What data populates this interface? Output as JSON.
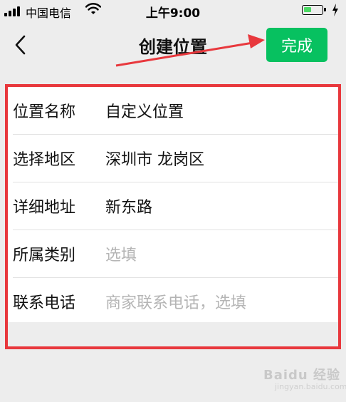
{
  "status_bar": {
    "carrier": "中国电信",
    "time": "上午9:00",
    "battery_level": 0.45
  },
  "nav": {
    "title": "创建位置",
    "done_label": "完成",
    "accent_color": "#07c160"
  },
  "form": {
    "rows": [
      {
        "label": "位置名称",
        "value": "自定义位置",
        "placeholder": ""
      },
      {
        "label": "选择地区",
        "value": "深圳市 龙岗区",
        "placeholder": ""
      },
      {
        "label": "详细地址",
        "value": "新东路",
        "placeholder": ""
      },
      {
        "label": "所属类别",
        "value": "",
        "placeholder": "选填"
      },
      {
        "label": "联系电话",
        "value": "",
        "placeholder": "商家联系电话，选填"
      }
    ]
  },
  "annotation": {
    "frame_color": "#e8383d"
  },
  "watermark": {
    "text": "Baidu 经验",
    "sub": "jingyan.baidu.com"
  }
}
